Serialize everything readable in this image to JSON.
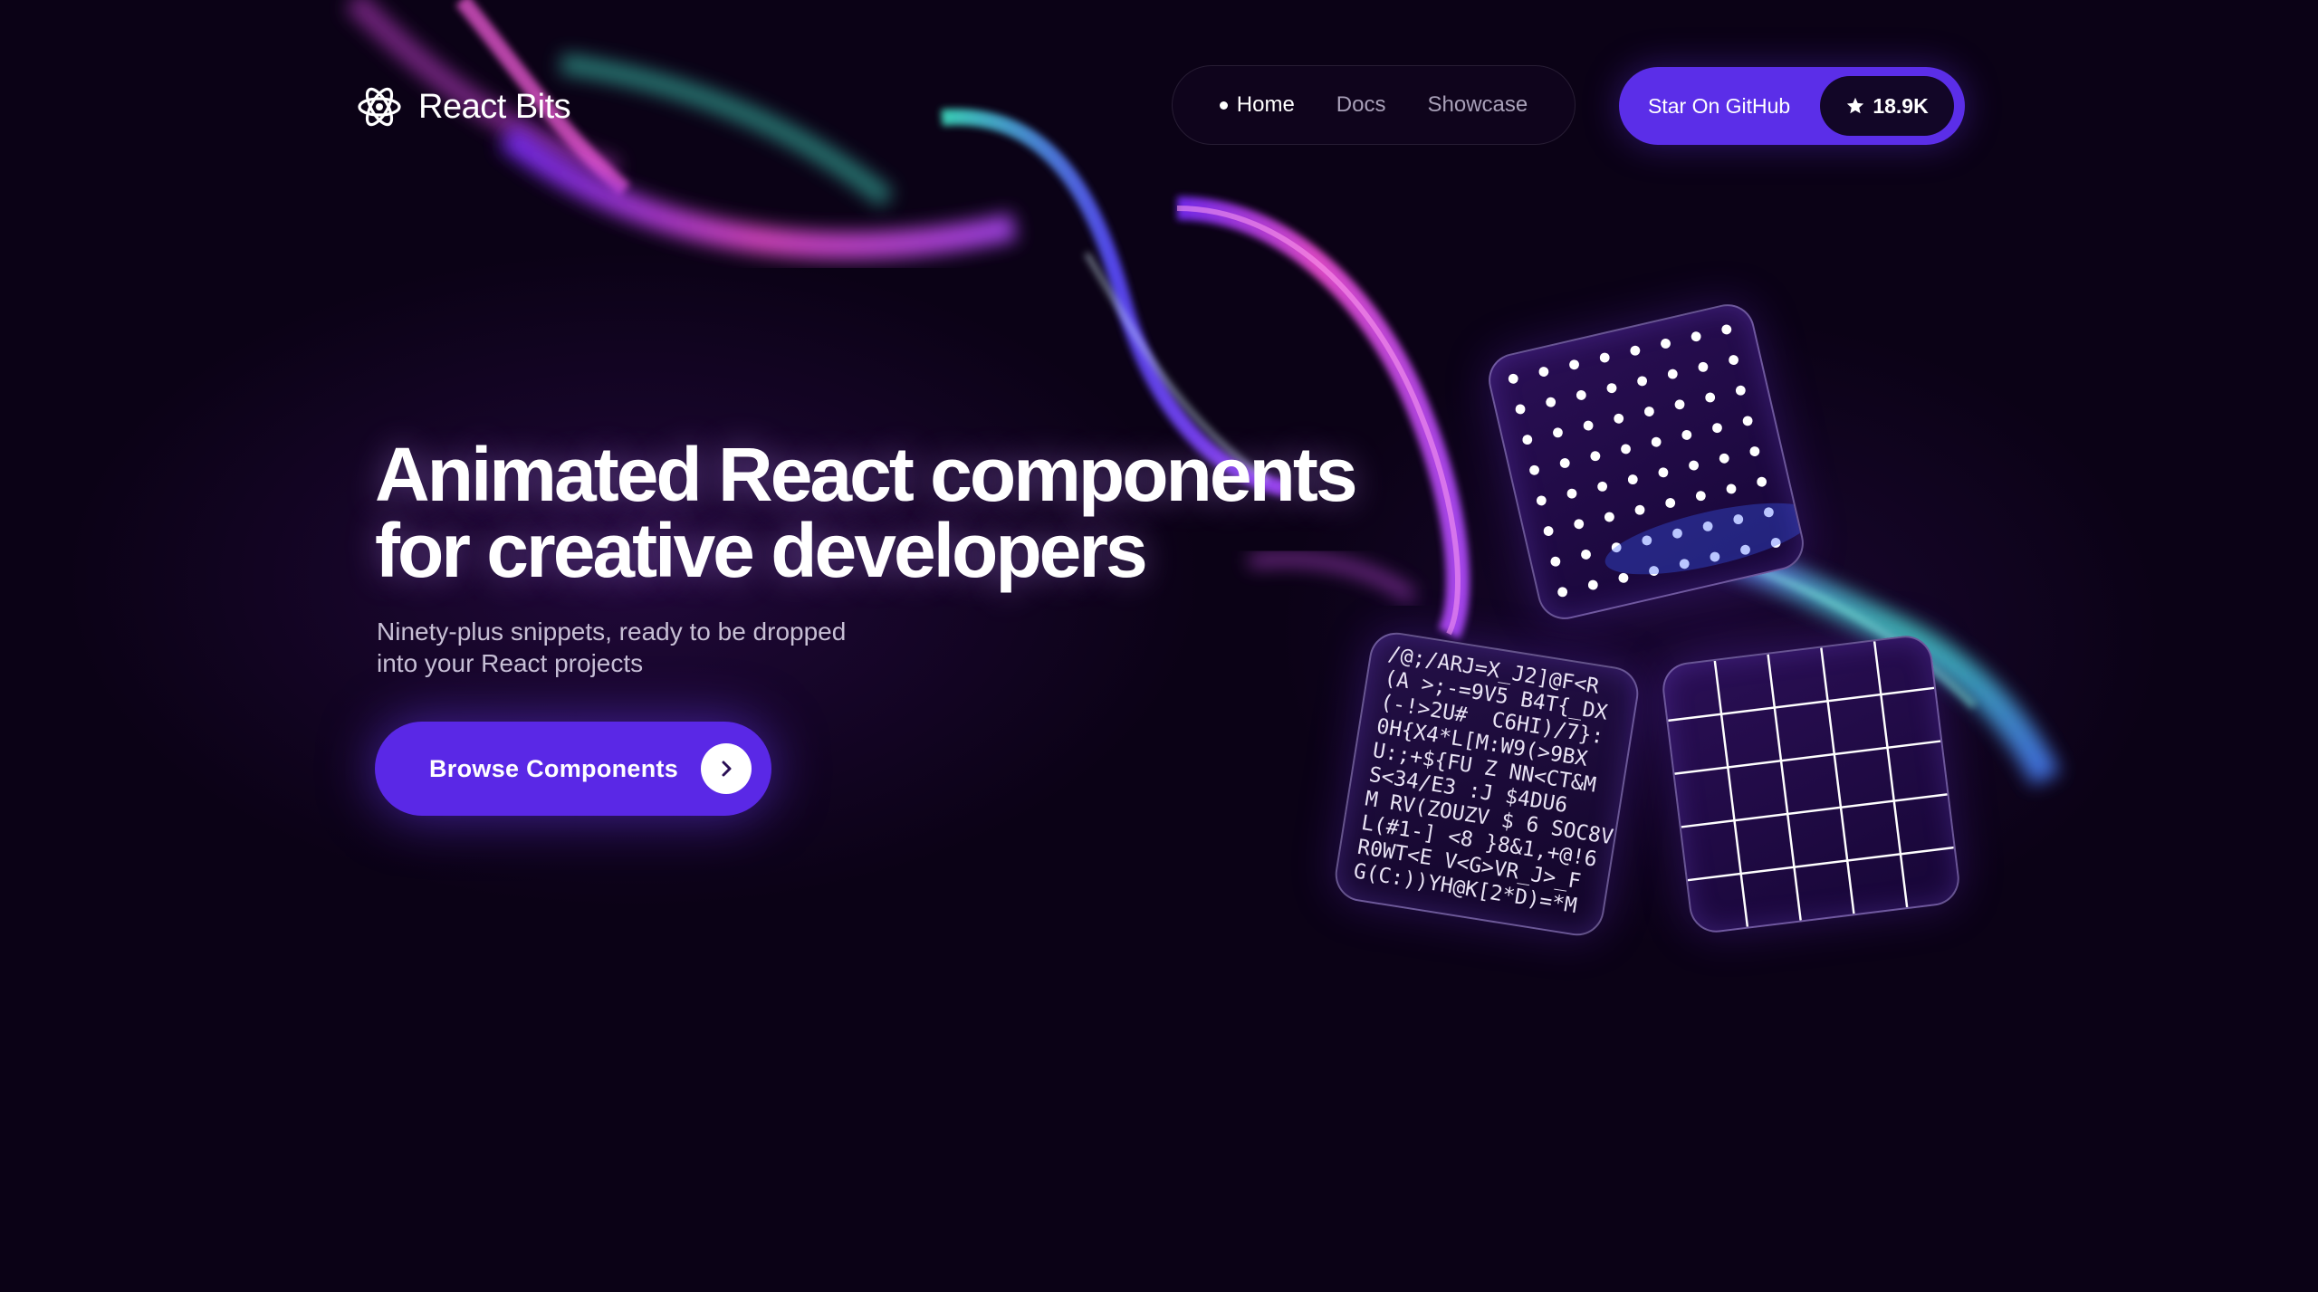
{
  "brand": {
    "name": "React Bits",
    "logo_icon": "atom-icon"
  },
  "nav": {
    "items": [
      {
        "label": "Home",
        "active": true
      },
      {
        "label": "Docs",
        "active": false
      },
      {
        "label": "Showcase",
        "active": false
      }
    ]
  },
  "github": {
    "label": "Star On GitHub",
    "stars": "18.9K",
    "icon": "star-icon"
  },
  "hero": {
    "title_line1": "Animated React components",
    "title_line2": "for creative developers",
    "subtitle_line1": "Ninety-plus snippets, ready to be dropped",
    "subtitle_line2": "into your React projects",
    "cta_label": "Browse Components",
    "cta_icon": "chevron-right-icon"
  },
  "tiles": {
    "ascii_lines": [
      "/@;/ARJ=X_J2]@F<R",
      "(A >;-=9V5 B4T{_DX",
      "(-!>2U#  C6HI)/7}:",
      "0H{X4*L[M:W9(>9BX",
      "U:;+${FU Z NN<CT&M",
      "S<34/E3 :J $4DU6",
      "M RV(ZOUZV $ 6 SOC8V",
      "L(#1-] <8 }8&1,+@!6",
      "R0WT<E V<G>VR_J>_F",
      "G(C:))YH@K[2*D)=*M"
    ]
  },
  "colors": {
    "background": "#0b0216",
    "accent_purple": "#5b2ee8",
    "ribbon_pink": "#e04ad0",
    "ribbon_teal": "#3fd9c0"
  }
}
